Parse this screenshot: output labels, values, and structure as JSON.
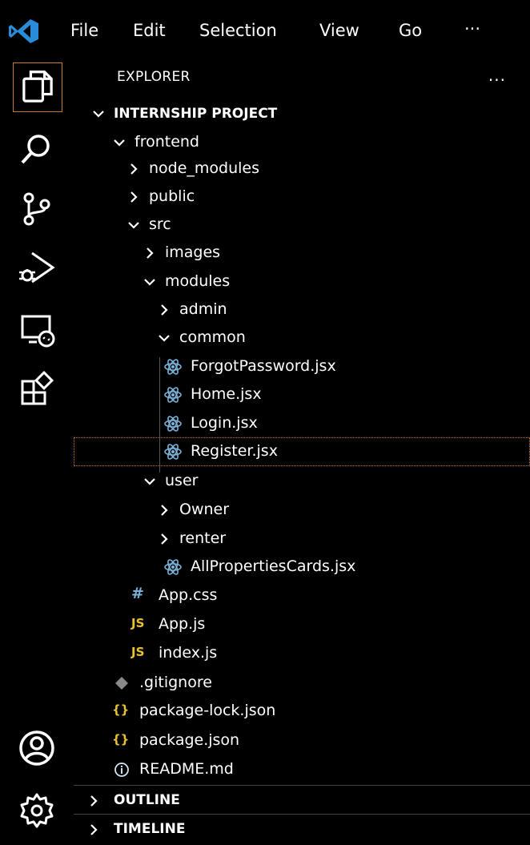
{
  "menu": {
    "items": [
      "File",
      "Edit",
      "Selection",
      "View",
      "Go",
      "..."
    ]
  },
  "explorer": {
    "title": "EXPLORER",
    "more": "...",
    "tree": [
      {
        "label": "INTERNSHIP PROJECT",
        "expanded": true,
        "root": true
      },
      {
        "label": "frontend",
        "expanded": true
      },
      {
        "label": "node_modules",
        "expanded": false
      },
      {
        "label": "public",
        "expanded": false
      },
      {
        "label": "src",
        "expanded": true
      },
      {
        "label": "images",
        "expanded": false
      },
      {
        "label": "modules",
        "expanded": true
      },
      {
        "label": "admin",
        "expanded": false
      },
      {
        "label": "common",
        "expanded": true
      },
      {
        "label": "ForgotPassword.jsx",
        "icon": "react-icon"
      },
      {
        "label": "Home.jsx",
        "icon": "react-icon"
      },
      {
        "label": "Login.jsx",
        "icon": "react-icon"
      },
      {
        "label": "Register.jsx",
        "icon": "react-icon",
        "selected": true
      },
      {
        "label": "user",
        "expanded": true
      },
      {
        "label": "Owner",
        "expanded": false
      },
      {
        "label": "renter",
        "expanded": false
      },
      {
        "label": "AllPropertiesCards.jsx",
        "icon": "react-icon"
      },
      {
        "label": "App.css",
        "icon": "css-icon",
        "icon_text": "#"
      },
      {
        "label": "App.js",
        "icon": "js-icon",
        "icon_text": "JS"
      },
      {
        "label": "index.js",
        "icon": "js-icon",
        "icon_text": "JS"
      },
      {
        "label": ".gitignore",
        "icon": "git-icon"
      },
      {
        "label": "package-lock.json",
        "icon": "json-icon",
        "icon_text": "{}"
      },
      {
        "label": "package.json",
        "icon": "json-icon",
        "icon_text": "{}"
      },
      {
        "label": "README.md",
        "icon": "info-icon"
      }
    ]
  },
  "sections": {
    "outline": "OUTLINE",
    "timeline": "TIMELINE"
  },
  "colors": {
    "react": "#7ab3d9",
    "js": "#e8c331",
    "json": "#e8c331",
    "css": "#7ab3d9",
    "selection_border": "#c97a2a",
    "logo": "#2a8cd8"
  }
}
